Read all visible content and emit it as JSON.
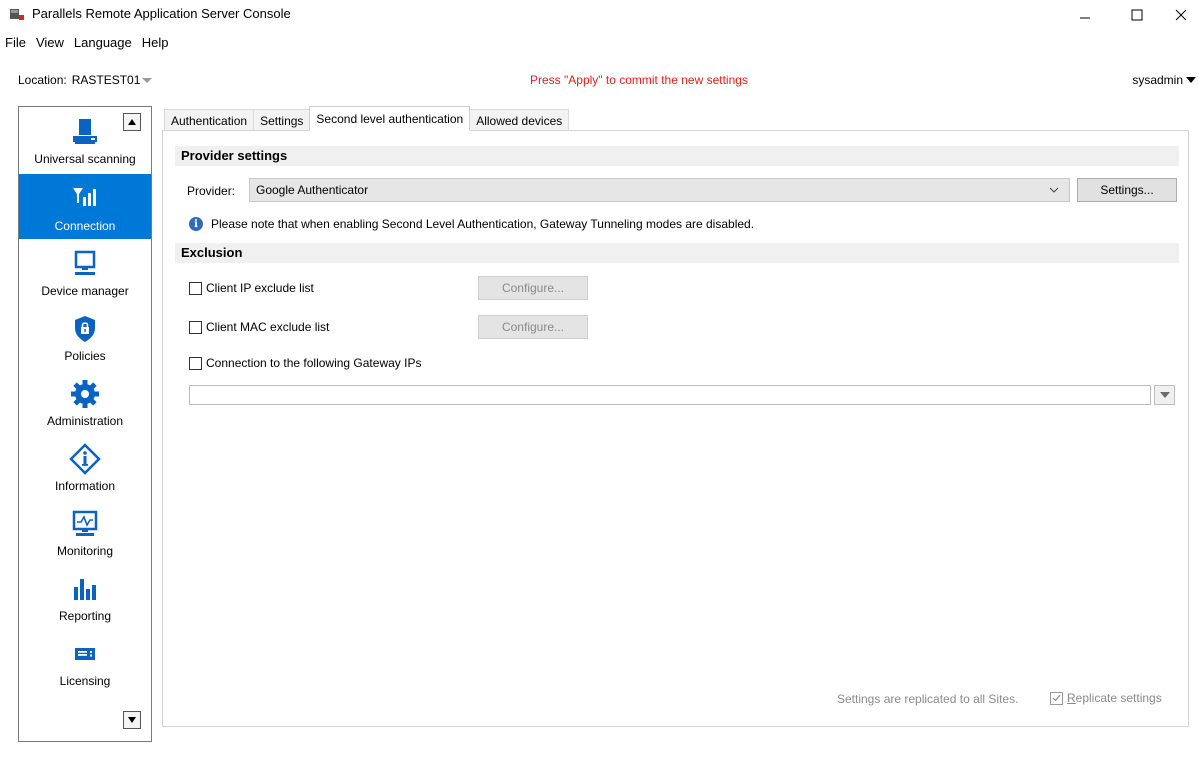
{
  "window": {
    "title": "Parallels Remote Application Server Console"
  },
  "menu": [
    "File",
    "View",
    "Language",
    "Help"
  ],
  "location": {
    "label": "Location:",
    "value": "RASTEST01"
  },
  "notice": "Press \"Apply\" to commit the new settings",
  "user": "sysadmin",
  "sidebar": {
    "items": [
      {
        "label": "Universal scanning",
        "icon": "scanner-icon",
        "active": false
      },
      {
        "label": "Connection",
        "icon": "signal-icon",
        "active": true
      },
      {
        "label": "Device manager",
        "icon": "monitor-icon",
        "active": false
      },
      {
        "label": "Policies",
        "icon": "shield-lock-icon",
        "active": false
      },
      {
        "label": "Administration",
        "icon": "gear-icon",
        "active": false
      },
      {
        "label": "Information",
        "icon": "info-diamond-icon",
        "active": false
      },
      {
        "label": "Monitoring",
        "icon": "monitoring-screen-icon",
        "active": false
      },
      {
        "label": "Reporting",
        "icon": "bar-chart-icon",
        "active": false
      },
      {
        "label": "Licensing",
        "icon": "license-card-icon",
        "active": false
      }
    ]
  },
  "tabs": [
    {
      "label": "Authentication",
      "active": false
    },
    {
      "label": "Settings",
      "active": false
    },
    {
      "label": "Second level authentication",
      "active": true
    },
    {
      "label": "Allowed devices",
      "active": false
    }
  ],
  "provider_section": {
    "header": "Provider settings",
    "provider_label": "Provider:",
    "provider_value": "Google Authenticator",
    "settings_button": "Settings...",
    "note": "Please note that when enabling Second Level Authentication, Gateway Tunneling modes are disabled."
  },
  "exclusion_section": {
    "header": "Exclusion",
    "client_ip": {
      "label": "Client IP exclude list",
      "checked": false,
      "button": "Configure..."
    },
    "client_mac": {
      "label": "Client MAC exclude list",
      "checked": false,
      "button": "Configure..."
    },
    "gateway": {
      "label": "Connection to the following Gateway IPs",
      "checked": false,
      "value": ""
    }
  },
  "footer": {
    "replicated_text": "Settings are replicated to all Sites.",
    "replicate_first": "R",
    "replicate_rest": "eplicate settings",
    "replicate_checked": true
  },
  "colors": {
    "accent": "#0078d7",
    "notice": "#e0201b",
    "icon_blue": "#0a62c2"
  }
}
